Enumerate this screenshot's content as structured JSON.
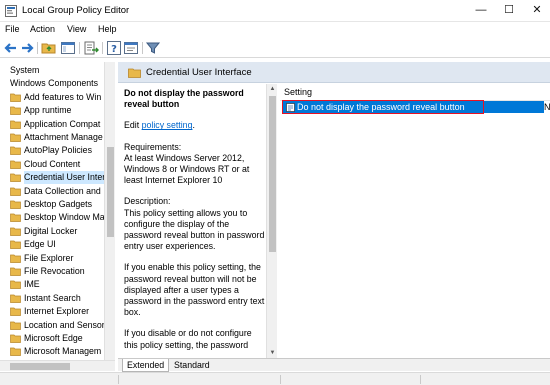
{
  "window": {
    "title": "Local Group Policy Editor",
    "minimize_glyph": "—",
    "maximize_glyph": "☐",
    "close_glyph": "✕"
  },
  "menu": {
    "items": [
      "File",
      "Action",
      "View",
      "Help"
    ]
  },
  "toolbar": {
    "icons": [
      "back-arrow-icon",
      "forward-arrow-icon",
      "folder-up-icon",
      "show-hide-tree-icon",
      "export-list-icon",
      "help-icon",
      "properties-icon",
      "filter-icon"
    ]
  },
  "tree": {
    "items": [
      {
        "label": "System",
        "level": 0
      },
      {
        "label": "Windows Components",
        "level": 0
      },
      {
        "label": "Add features to Win",
        "level": 1
      },
      {
        "label": "App runtime",
        "level": 1
      },
      {
        "label": "Application Compat",
        "level": 1
      },
      {
        "label": "Attachment Manage",
        "level": 1
      },
      {
        "label": "AutoPlay Policies",
        "level": 1
      },
      {
        "label": "Cloud Content",
        "level": 1
      },
      {
        "label": "Credential User Inter",
        "level": 1,
        "selected": true
      },
      {
        "label": "Data Collection and",
        "level": 1
      },
      {
        "label": "Desktop Gadgets",
        "level": 1
      },
      {
        "label": "Desktop Window Ma",
        "level": 1
      },
      {
        "label": "Digital Locker",
        "level": 1
      },
      {
        "label": "Edge UI",
        "level": 1
      },
      {
        "label": "File Explorer",
        "level": 1
      },
      {
        "label": "File Revocation",
        "level": 1
      },
      {
        "label": "IME",
        "level": 1
      },
      {
        "label": "Instant Search",
        "level": 1
      },
      {
        "label": "Internet Explorer",
        "level": 1
      },
      {
        "label": "Location and Sensor",
        "level": 1
      },
      {
        "label": "Microsoft Edge",
        "level": 1
      },
      {
        "label": "Microsoft Managem",
        "level": 1
      }
    ]
  },
  "header": {
    "title": "Credential User Interface"
  },
  "description": {
    "heading": "Do not display the password reveal button",
    "edit_prefix": "Edit ",
    "edit_link": "policy setting",
    "edit_suffix": ".",
    "requirements_label": "Requirements:",
    "requirements_text": "At least Windows Server 2012, Windows 8 or Windows RT or at least Internet Explorer 10",
    "description_label": "Description:",
    "description_text": "This policy setting allows you to configure the display of the password reveal button in password entry user experiences.",
    "para_enable": "If you enable this policy setting, the password reveal button will not be displayed after a user types a password in the password entry text box.",
    "para_disable": "If you disable or do not configure this policy setting, the password"
  },
  "settings": {
    "column_header": "Setting",
    "rows": [
      {
        "label": "Do not display the password reveal button",
        "state": "N",
        "selected": true
      }
    ]
  },
  "tabs": {
    "extended": "Extended",
    "standard": "Standard"
  },
  "colors": {
    "selection": "#0078d7",
    "highlight_frame": "#e81123",
    "header_band": "#dfe7f1",
    "folder": "#e8b84a"
  }
}
